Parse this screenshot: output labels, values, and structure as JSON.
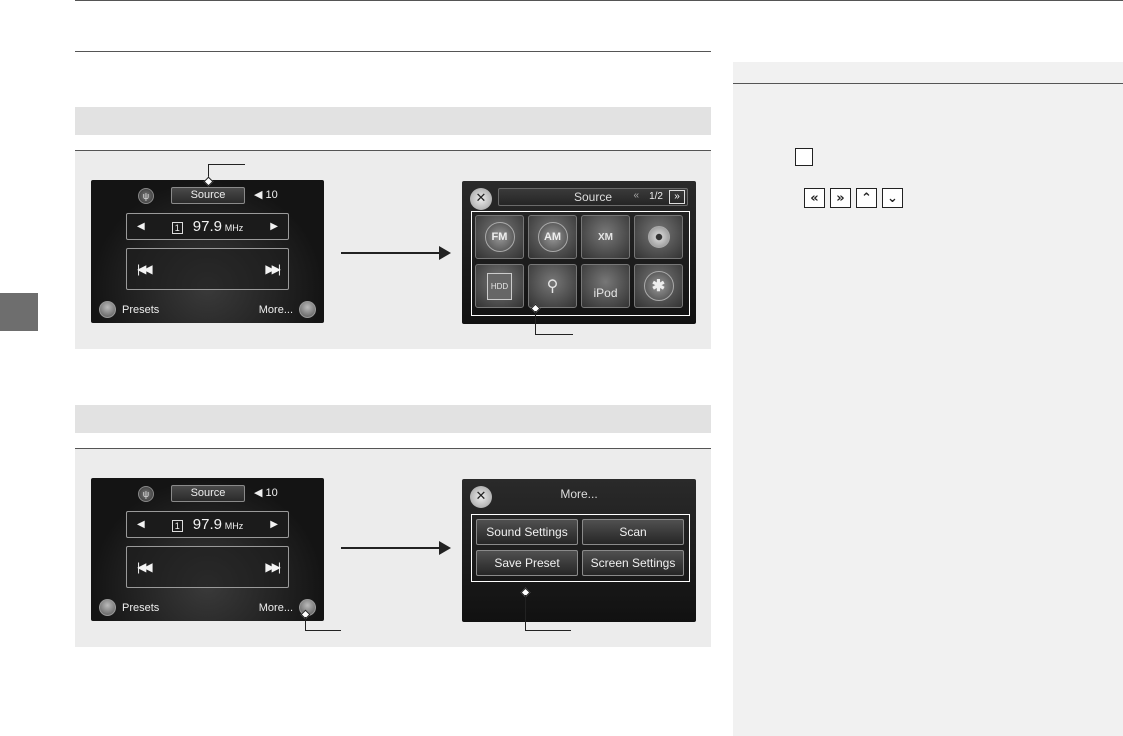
{
  "sidebar": {
    "buttons": [
      "«",
      "»",
      "⌃",
      "⌄"
    ]
  },
  "diagram1": {
    "radio": {
      "source_label": "Source",
      "volume": "10",
      "preset_number": "1",
      "frequency": "97.9",
      "unit": "MHz",
      "presets_label": "Presets",
      "more_label": "More..."
    },
    "source_screen": {
      "title": "Source",
      "page": "1/2",
      "items": [
        "FM",
        "AM",
        "XM",
        "Disc",
        "HDD",
        "USB",
        "iPod",
        "Bluetooth"
      ],
      "item_text": [
        "FM",
        "AM",
        "XM",
        "",
        "HDD",
        "⚲",
        "iPod",
        "✱"
      ]
    }
  },
  "diagram2": {
    "radio": {
      "source_label": "Source",
      "volume": "10",
      "preset_number": "1",
      "frequency": "97.9",
      "unit": "MHz",
      "presets_label": "Presets",
      "more_label": "More..."
    },
    "more_screen": {
      "title": "More...",
      "buttons": [
        "Sound Settings",
        "Scan",
        "Save Preset",
        "Screen Settings"
      ]
    }
  }
}
